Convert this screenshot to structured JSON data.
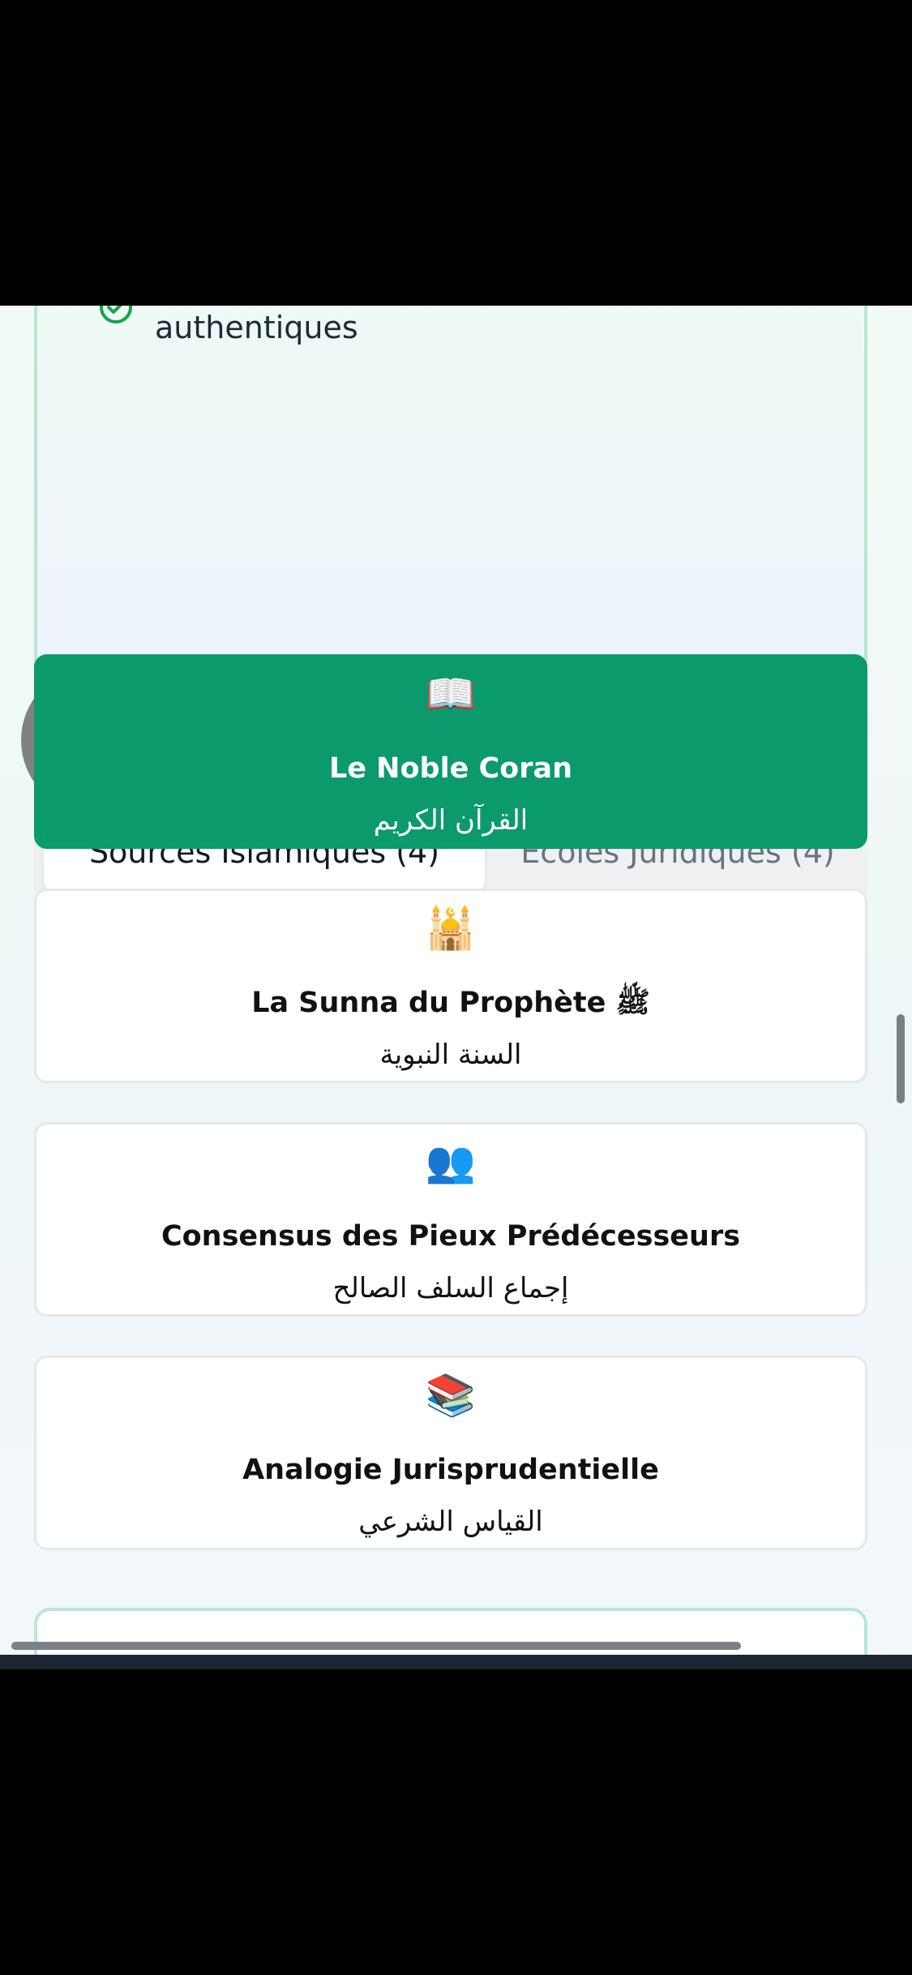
{
  "info_box": {
    "text": "authentiques",
    "icon": "check-circle-icon"
  },
  "tabs": [
    {
      "label": "Sources Islamiques (4)",
      "active": true
    },
    {
      "label": "Écoles Juridiques (4)",
      "active": false
    }
  ],
  "sources": [
    {
      "emoji": "📖",
      "icon": "open-book-icon",
      "title": "Le Noble Coran",
      "arabic": "القرآن الكريم",
      "selected": true
    },
    {
      "emoji": "🕌",
      "icon": "mosque-icon",
      "title": "La Sunna du Prophète ﷺ",
      "arabic": "السنة النبوية",
      "selected": false
    },
    {
      "emoji": "👥",
      "icon": "people-icon",
      "title": "Consensus des Pieux Prédécesseurs",
      "arabic": "إجماع السلف الصالح",
      "selected": false
    },
    {
      "emoji": "📚",
      "icon": "books-icon",
      "title": "Analogie Jurisprudentielle",
      "arabic": "القياس الشرعي",
      "selected": false
    }
  ],
  "colors": {
    "accent": "#0a9a6c",
    "card_border": "#e5e7eb",
    "info_border": "#b7e8d2"
  }
}
